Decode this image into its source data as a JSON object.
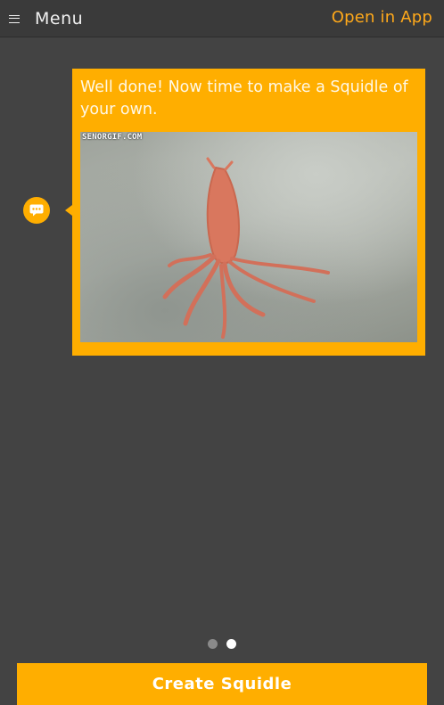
{
  "header": {
    "menu_label": "Menu",
    "menu_icon": "hamburger-icon",
    "open_in_app": "Open in App"
  },
  "message": {
    "avatar_icon": "chat-bubble-icon",
    "text": "Well done! Now time to make a Squidle of your own.",
    "gif_watermark": "SENORGIF.COM"
  },
  "pager": {
    "total": 2,
    "active": 2
  },
  "footer": {
    "create_label": "Create Squidle"
  },
  "colors": {
    "accent": "#ffae00",
    "background": "#434343",
    "link": "#ffa91a"
  }
}
